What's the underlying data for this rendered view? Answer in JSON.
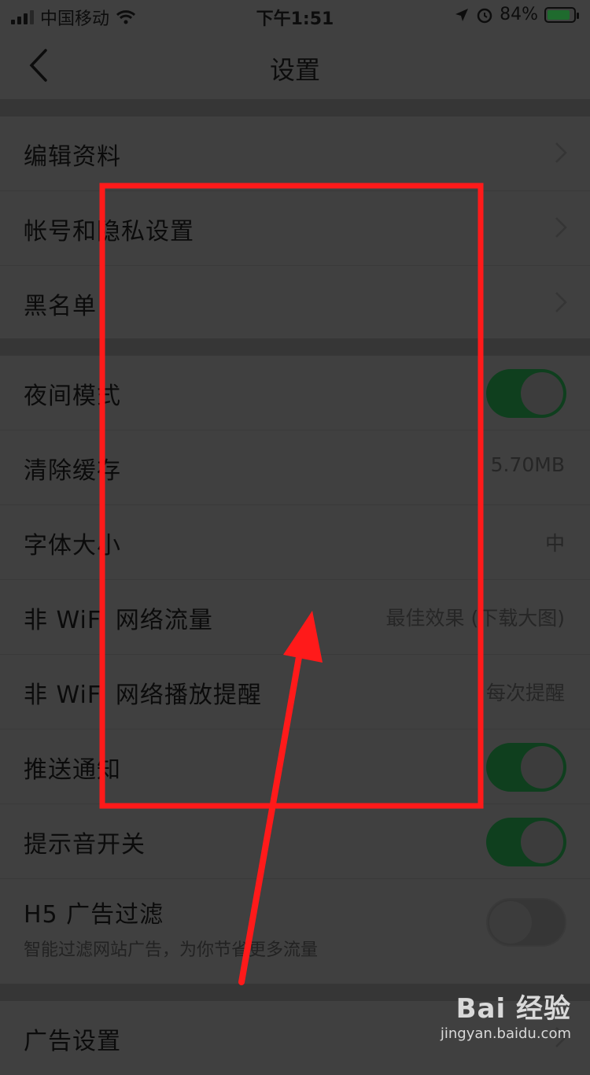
{
  "status_bar": {
    "carrier": "中国移动",
    "time": "下午1:51",
    "battery": "84%",
    "icons": [
      "signal-icon",
      "wifi-icon",
      "location-icon",
      "alarm-icon",
      "battery-charging-icon"
    ]
  },
  "nav": {
    "title": "设置",
    "back_icon": "chevron-left-icon"
  },
  "group1": {
    "edit_profile": "编辑资料",
    "account_privacy": "帐号和隐私设置",
    "blacklist": "黑名单"
  },
  "group2": {
    "night_mode": {
      "label": "夜间模式",
      "on": true
    },
    "clear_cache": {
      "label": "清除缓存",
      "value": "5.70MB"
    },
    "font_size": {
      "label": "字体大小",
      "value": "中"
    },
    "non_wifi_traffic": {
      "label": "非 WiFi 网络流量",
      "value": "最佳效果 (下载大图)"
    },
    "non_wifi_play": {
      "label": "非 WiFi 网络播放提醒",
      "value": "每次提醒"
    },
    "push": {
      "label": "推送通知",
      "on": true
    },
    "sound": {
      "label": "提示音开关",
      "on": true
    },
    "h5_ad": {
      "label": "H5 广告过滤",
      "sub": "智能过滤网站广告，为你节省更多流量",
      "on": false
    }
  },
  "group3": {
    "ad_settings": "广告设置"
  },
  "watermark": {
    "brand": "Bai 经验",
    "url": "jingyan.baidu.com"
  },
  "colors": {
    "background": "#404040",
    "toggle_on": "#0f3f1e",
    "annotation": "#ff1a1a"
  }
}
